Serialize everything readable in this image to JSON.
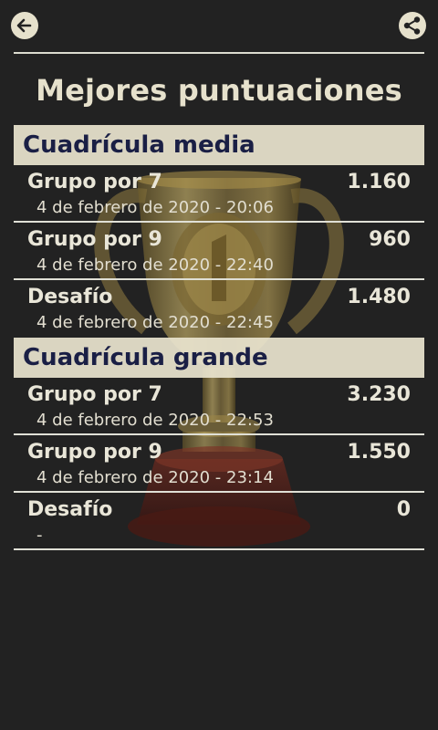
{
  "header": {
    "back_icon": "arrow-left-icon",
    "share_icon": "share-icon"
  },
  "page": {
    "title": "Mejores puntuaciones"
  },
  "sections": [
    {
      "title": "Cuadrícula media",
      "rows": [
        {
          "name": "Grupo por 7",
          "score": "1.160",
          "date": "4 de febrero de 2020 - 20:06"
        },
        {
          "name": "Grupo por 9",
          "score": "960",
          "date": "4 de febrero de 2020 - 22:40"
        },
        {
          "name": "Desafío",
          "score": "1.480",
          "date": "4 de febrero de 2020 - 22:45"
        }
      ]
    },
    {
      "title": "Cuadrícula grande",
      "rows": [
        {
          "name": "Grupo por 7",
          "score": "3.230",
          "date": "4 de febrero de 2020 - 22:53"
        },
        {
          "name": "Grupo por 9",
          "score": "1.550",
          "date": "4 de febrero de 2020 - 23:14"
        },
        {
          "name": "Desafío",
          "score": "0",
          "date": "-"
        }
      ]
    }
  ],
  "colors": {
    "background": "#222222",
    "header_bg": "#e8e3cd",
    "header_text": "#1a1f45",
    "text": "#e9e6d8"
  },
  "background_image": "trophy-icon"
}
